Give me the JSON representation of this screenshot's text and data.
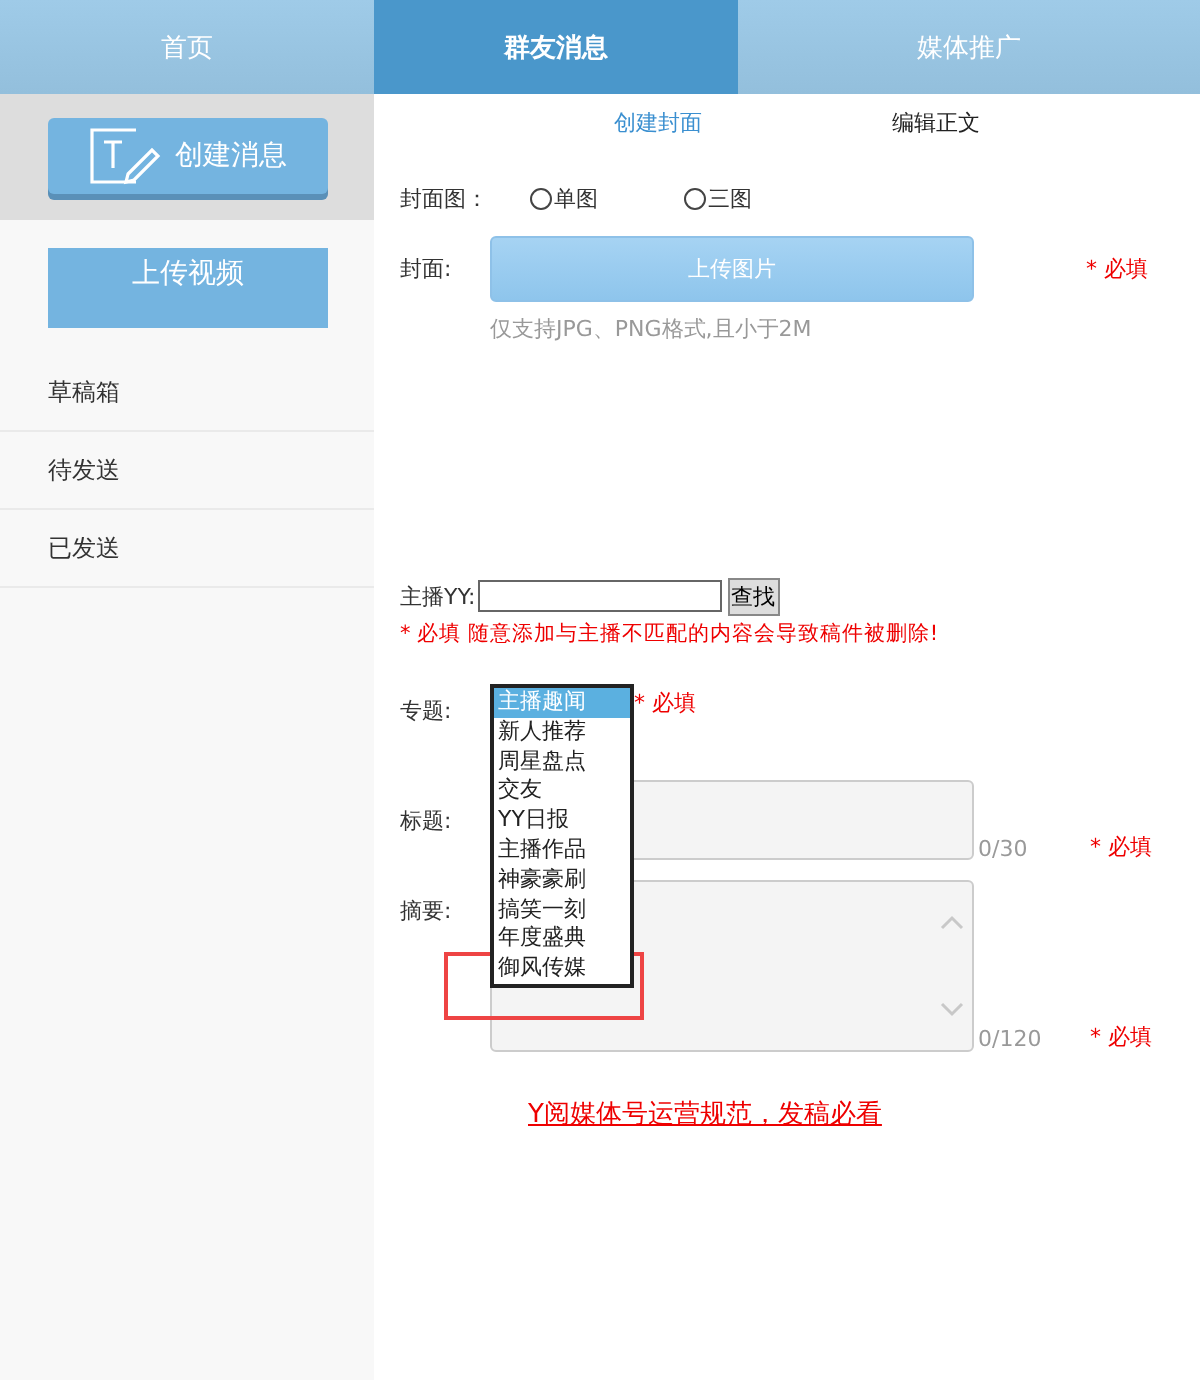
{
  "tabs": [
    {
      "label": "首页",
      "selected": false
    },
    {
      "label": "群友消息",
      "selected": true
    },
    {
      "label": "媒体推广",
      "selected": false
    }
  ],
  "sidebar": {
    "create_button": "创建消息",
    "upload_button": "上传视频",
    "items": [
      {
        "label": "草稿箱"
      },
      {
        "label": "待发送"
      },
      {
        "label": "已发送"
      }
    ]
  },
  "subtabs": [
    {
      "label": "创建封面",
      "selected": true
    },
    {
      "label": "编辑正文",
      "selected": false
    }
  ],
  "form": {
    "cover_type": {
      "label": "封面图：",
      "options": [
        {
          "label": "单图",
          "selected": false
        },
        {
          "label": "三图",
          "selected": false
        }
      ]
    },
    "cover": {
      "label": "封面:",
      "button": "上传图片",
      "required": "* 必填",
      "hint": "仅支持JPG、PNG格式,且小于2M"
    },
    "anchor": {
      "label": "主播YY:",
      "button": "查找",
      "warning": "* 必填 随意添加与主播不匹配的内容会导致稿件被删除!"
    },
    "topic": {
      "label": "专题:",
      "required": "* 必填",
      "options": [
        {
          "label": "主播趣闻",
          "selected": true
        },
        {
          "label": "新人推荐",
          "selected": false
        },
        {
          "label": "周星盘点",
          "selected": false
        },
        {
          "label": "交友",
          "selected": false
        },
        {
          "label": "YY日报",
          "selected": false
        },
        {
          "label": "主播作品",
          "selected": false
        },
        {
          "label": "神豪豪刷",
          "selected": false
        },
        {
          "label": "搞笑一刻",
          "selected": false
        },
        {
          "label": "年度盛典",
          "selected": false
        },
        {
          "label": "御风传媒",
          "selected": false
        }
      ]
    },
    "title": {
      "label": "标题:",
      "counter": "0/30",
      "required": "* 必填"
    },
    "summary": {
      "label": "摘要:",
      "counter": "0/120",
      "required": "* 必填"
    }
  },
  "link": "Y阅媒体号运营规范，发稿必看"
}
